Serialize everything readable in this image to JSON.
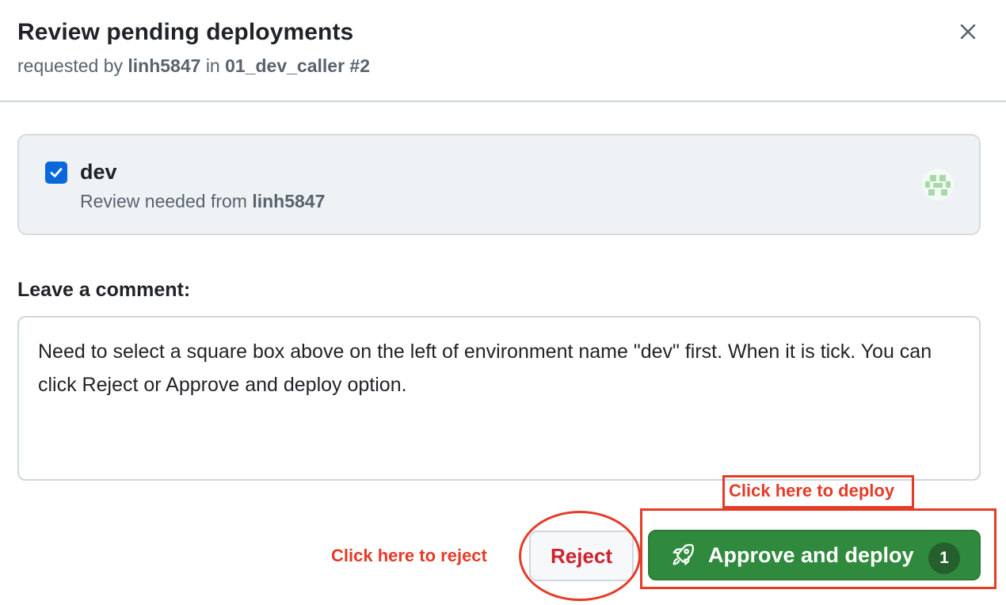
{
  "dialog": {
    "title": "Review pending deployments",
    "subtitle": {
      "prefix": "requested by",
      "user": "linh5847",
      "middle": "in",
      "workflow": "01_dev_caller #2"
    },
    "close_icon": "close-icon"
  },
  "environment": {
    "checked": true,
    "name": "dev",
    "review_prefix": "Review needed from",
    "reviewer": "linh5847",
    "avatar_icon": "identicon"
  },
  "comment": {
    "label": "Leave a comment:",
    "value": "Need to select a square box above on the left of environment name \"dev\" first. When it is tick. You can click Reject or Approve and deploy option."
  },
  "actions": {
    "reject_label": "Reject",
    "approve_label": "Approve and deploy",
    "approve_count": "1",
    "approve_icon": "rocket-icon"
  },
  "annotations": {
    "deploy_hint": "Click here to deploy",
    "reject_hint": "Click here to reject"
  },
  "colors": {
    "accent_blue": "#0969da",
    "approve_green": "#2f8a3d",
    "reject_red": "#cf222e",
    "annotation_red": "#e53b27"
  }
}
